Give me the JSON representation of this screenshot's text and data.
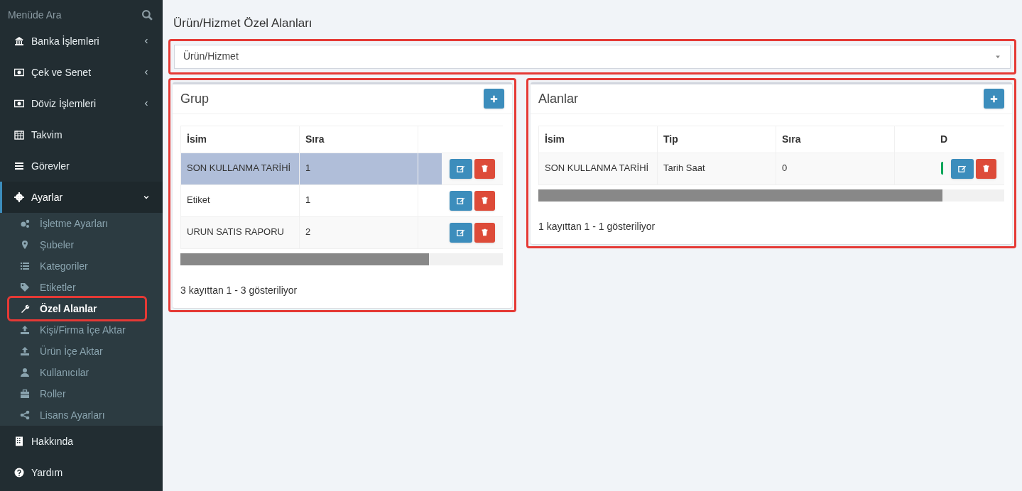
{
  "sidebar": {
    "search": {
      "placeholder": "Menüde Ara"
    },
    "items": [
      {
        "label": "Banka İşlemleri",
        "selected": false,
        "expanded": false
      },
      {
        "label": "Çek ve Senet",
        "selected": false,
        "expanded": false
      },
      {
        "label": "Döviz İşlemleri",
        "selected": false,
        "expanded": false
      },
      {
        "label": "Takvim",
        "selected": false
      },
      {
        "label": "Görevler",
        "selected": false
      },
      {
        "label": "Ayarlar",
        "selected": true,
        "expanded": true,
        "children": [
          {
            "label": "İşletme Ayarları",
            "selected": false
          },
          {
            "label": "Şubeler",
            "selected": false
          },
          {
            "label": "Kategoriler",
            "selected": false
          },
          {
            "label": "Etiketler",
            "selected": false
          },
          {
            "label": "Özel Alanlar",
            "selected": true
          },
          {
            "label": "Kişi/Firma İçe Aktar",
            "selected": false
          },
          {
            "label": "Ürün İçe Aktar",
            "selected": false
          },
          {
            "label": "Kullanıcılar",
            "selected": false
          },
          {
            "label": "Roller",
            "selected": false
          },
          {
            "label": "Lisans Ayarları",
            "selected": false
          }
        ]
      },
      {
        "label": "Hakkında",
        "selected": false
      },
      {
        "label": "Yardım",
        "selected": false
      }
    ]
  },
  "page_title": "Ürün/Hizmet Özel Alanları",
  "type_select": {
    "value": "Ürün/Hizmet"
  },
  "panels": [
    {
      "title": "Grup",
      "columns": [
        "İsim",
        "Sıra"
      ],
      "rows": [
        {
          "cells": [
            "SON KULLANMA TARİHİ",
            "1"
          ],
          "selected": true
        },
        {
          "cells": [
            "Etiket",
            "1"
          ],
          "selected": false
        },
        {
          "cells": [
            "URUN SATIS RAPORU",
            "2"
          ],
          "selected": false
        }
      ],
      "footer": "3 kayıttan 1 - 3 gösteriliyor"
    },
    {
      "title": "Alanlar",
      "columns": [
        "İsim",
        "Tip",
        "Sıra",
        "D"
      ],
      "rows": [
        {
          "cells": [
            "SON KULLANMA TARİHİ",
            "Tarih Saat",
            "0"
          ],
          "selected": false
        }
      ],
      "footer": "1 kayıttan 1 - 1 gösteriliyor"
    }
  ]
}
